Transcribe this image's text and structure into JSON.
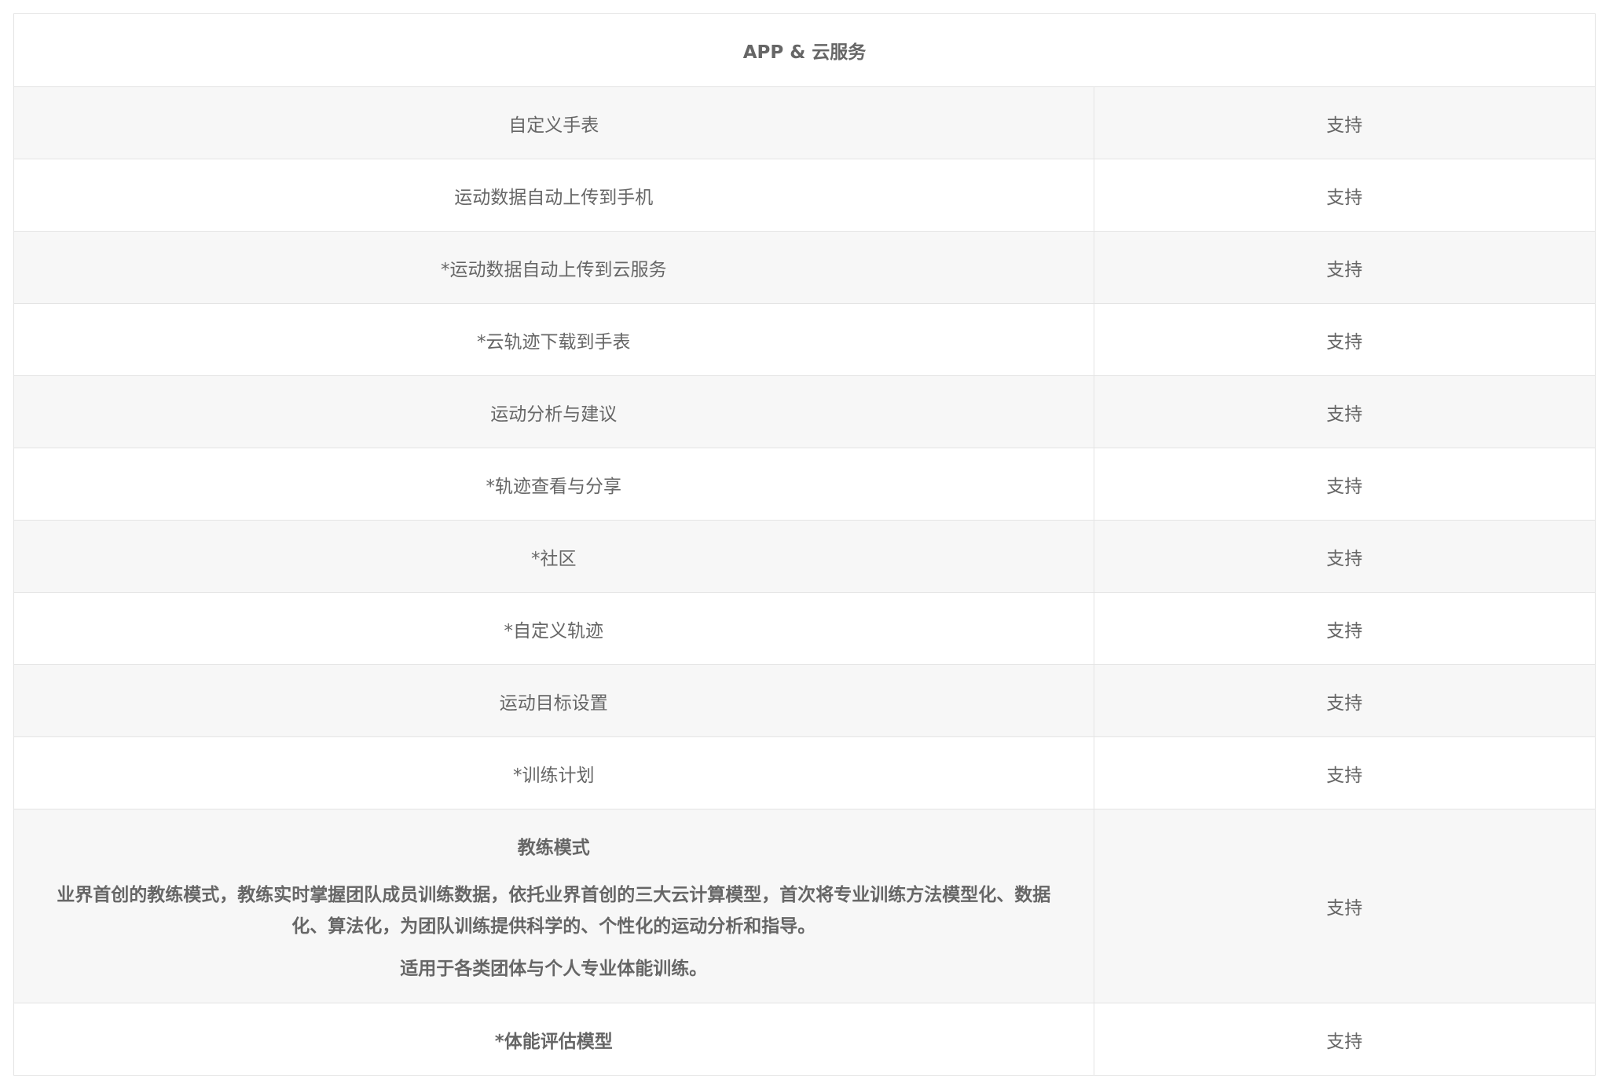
{
  "section_title": "APP & 云服务",
  "rows": [
    {
      "feature": "自定义手表",
      "value": "支持"
    },
    {
      "feature": "运动数据自动上传到手机",
      "value": "支持"
    },
    {
      "feature": "*运动数据自动上传到云服务",
      "value": "支持"
    },
    {
      "feature": "*云轨迹下载到手表",
      "value": "支持"
    },
    {
      "feature": "运动分析与建议",
      "value": "支持"
    },
    {
      "feature": "*轨迹查看与分享",
      "value": "支持"
    },
    {
      "feature": "*社区",
      "value": "支持"
    },
    {
      "feature": "*自定义轨迹",
      "value": "支持"
    },
    {
      "feature": "运动目标设置",
      "value": "支持"
    },
    {
      "feature": "*训练计划",
      "value": "支持"
    }
  ],
  "coach": {
    "title": "教练模式",
    "description": "业界首创的教练模式，教练实时掌握团队成员训练数据，依托业界首创的三大云计算模型，首次将专业训练方法模型化、数据化、算法化，为团队训练提供科学的、个性化的运动分析和指导。",
    "note": "适用于各类团体与个人专业体能训练。",
    "value": "支持"
  },
  "fitness": {
    "feature": "*体能评估模型",
    "value": "支持"
  }
}
